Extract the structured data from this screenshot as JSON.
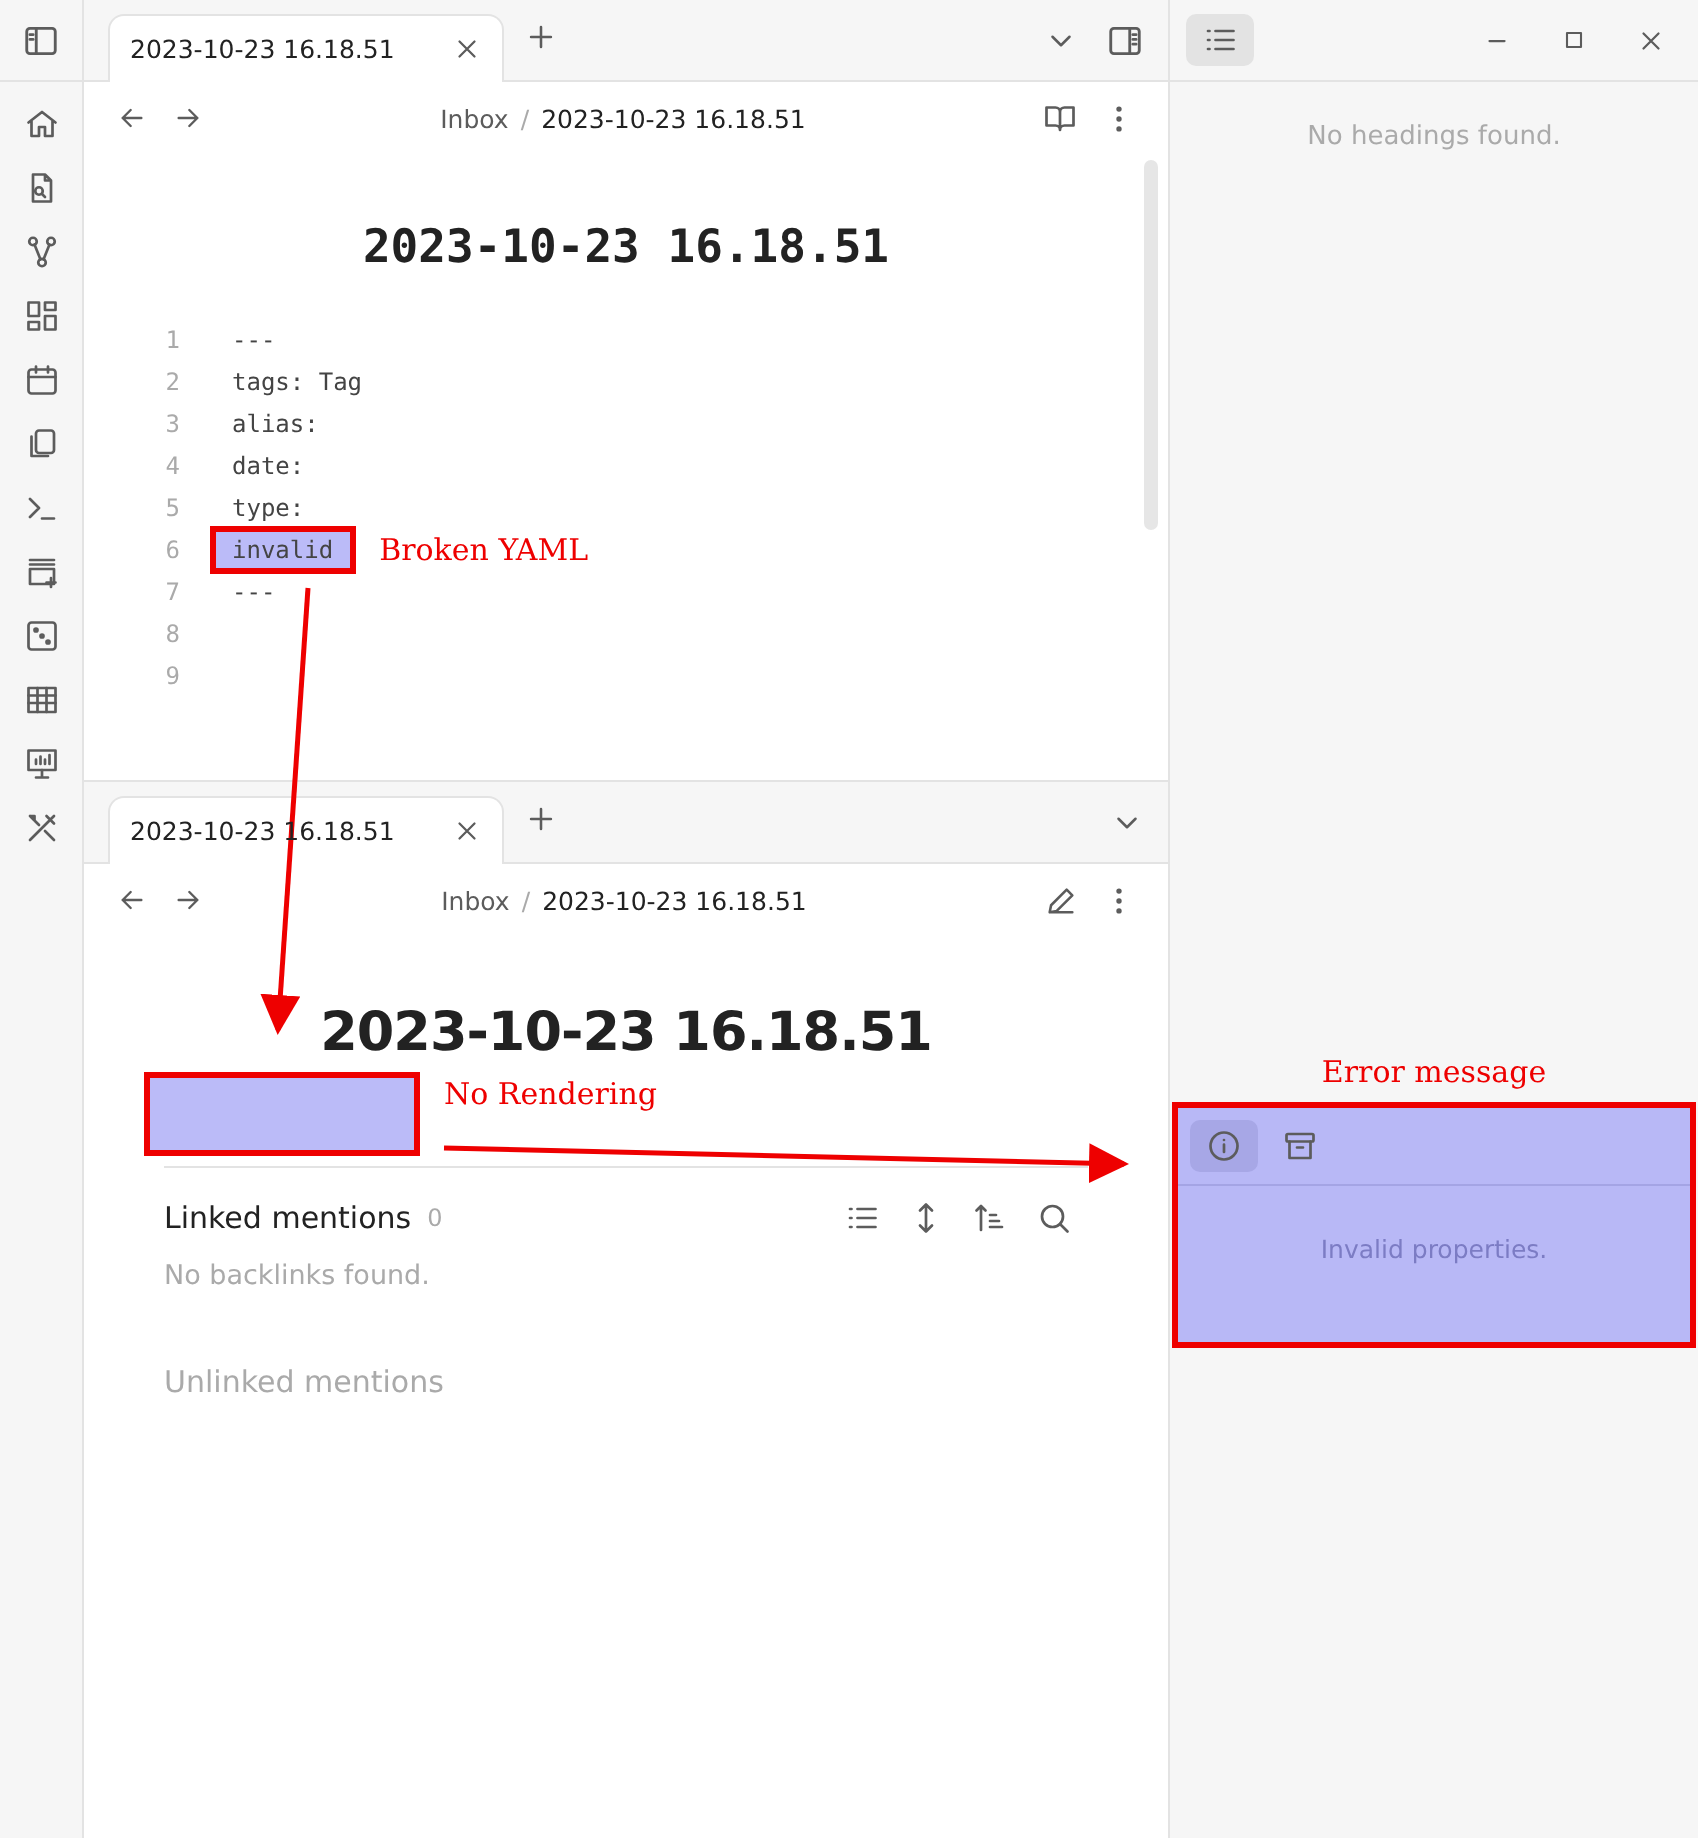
{
  "top_pane": {
    "tabs": [
      {
        "label": "2023-10-23 16.18.51",
        "selected": true
      }
    ],
    "breadcrumb": {
      "folder": "Inbox",
      "separator": "/",
      "file": "2023-10-23 16.18.51"
    },
    "title": "2023-10-23 16.18.51",
    "lines": [
      {
        "number": "1",
        "text": "---",
        "highlighted": false
      },
      {
        "number": "2",
        "text": "tags: Tag",
        "highlighted": false
      },
      {
        "number": "3",
        "text": "alias:",
        "highlighted": false
      },
      {
        "number": "4",
        "text": "date:",
        "highlighted": false
      },
      {
        "number": "5",
        "text": "type:",
        "highlighted": false
      },
      {
        "number": "6",
        "text": "invalid",
        "highlighted": true,
        "annotation": "Broken YAML"
      },
      {
        "number": "7",
        "text": "---",
        "highlighted": false
      },
      {
        "number": "8"
      },
      {
        "number": "9"
      }
    ]
  },
  "bottom_pane": {
    "tabs": [
      {
        "label": "2023-10-23 16.18.51",
        "selected": true
      }
    ],
    "breadcrumb": {
      "folder": "Inbox",
      "separator": "/",
      "file": "2023-10-23 16.18.51"
    },
    "title": "2023-10-23 16.18.51",
    "properties_annotation": "No Rendering",
    "linked_mentions": {
      "title": "Linked mentions",
      "count": "0",
      "empty": "No backlinks found."
    },
    "unlinked_mentions": {
      "title": "Unlinked mentions"
    }
  },
  "right_panel": {
    "outline_selected": true,
    "outline_empty": "No headings found.",
    "error_panel": {
      "annotation": "Error message",
      "tabs": [
        {
          "kind": "info",
          "selected": true
        },
        {
          "kind": "archive",
          "selected": false
        }
      ],
      "message": "Invalid properties."
    }
  }
}
